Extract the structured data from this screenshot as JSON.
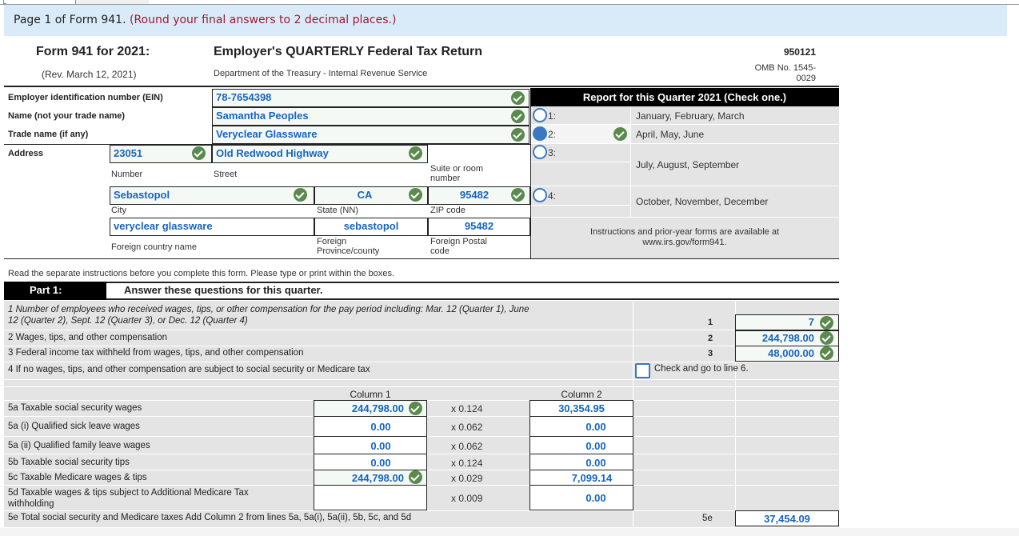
{
  "banner": {
    "text": "Page 1 of Form 941.",
    "hint": "(Round your final answers to 2 decimal places.)"
  },
  "header": {
    "form_title": "Form 941 for 2021:",
    "revision": "(Rev. March 12, 2021)",
    "title": "Employer's QUARTERLY Federal Tax Return",
    "department": "Department of the Treasury - Internal Revenue Service",
    "form_code": "950121",
    "omb_line1": "OMB No. 1545-",
    "omb_line2": "0029"
  },
  "employer": {
    "ein_label": "Employer identification number (EIN)",
    "ein_value": "78-7654398",
    "name_label": "Name (not your trade name)",
    "name_value": "Samantha Peoples",
    "trade_label": "Trade name (if any)",
    "trade_value": "Veryclear Glassware",
    "address_label": "Address",
    "number_value": "23051",
    "number_label": "Number",
    "street_value": "Old Redwood Highway",
    "street_label": "Street",
    "suite_label": "Suite or room number",
    "city_value": "Sebastopol",
    "city_label": "City",
    "state_value": "CA",
    "state_label": "State (NN)",
    "zip_value": "95482",
    "zip_label": "ZIP code",
    "foreign_country_value": "veryclear glassware",
    "foreign_country_label": "Foreign country name",
    "foreign_province_value": "sebastopol",
    "foreign_province_label_1": "Foreign",
    "foreign_province_label_2": "Province/county",
    "foreign_postal_value": "95482",
    "foreign_postal_label_1": "Foreign Postal",
    "foreign_postal_label_2": "code"
  },
  "quarter": {
    "heading": "Report for this Quarter 2021 (Check one.)",
    "options": [
      {
        "num": "1:",
        "months": "January, February, March",
        "selected": false
      },
      {
        "num": "2:",
        "months": "April, May, June",
        "selected": true
      },
      {
        "num": "3:",
        "months": "July, August, September",
        "selected": false
      },
      {
        "num": "4:",
        "months": "October, November, December",
        "selected": false
      }
    ],
    "instructions_1": "Instructions and prior-year forms are available at",
    "instructions_2": "www.irs.gov/form941."
  },
  "read_note": "Read the separate instructions before you complete this form.  Please type or print within the boxes.",
  "part1": {
    "label": "Part 1:",
    "title": "Answer these questions for this quarter.",
    "line1_text_1": "1  Number of employees who received wages, tips, or other compensation for the pay period including: Mar. 12 (Quarter 1), June",
    "line1_text_2": "12 (Quarter 2), Sept. 12 (Quarter 3), or Dec. 12 (Quarter 4)",
    "line1_num": "1",
    "line1_value": "7",
    "line2_text": "2  Wages, tips, and other compensation",
    "line2_num": "2",
    "line2_value": "244,798.00",
    "line3_text": "3  Federal income tax withheld from wages, tips, and other compensation",
    "line3_num": "3",
    "line3_value": "48,000.00",
    "line4_text": "4  If no wages, tips, and other compensation are subject to social security or Medicare tax",
    "line4_check_label": "Check and go to line 6.",
    "column1_label": "Column 1",
    "column2_label": "Column 2",
    "line5_rows": [
      {
        "label": "5a Taxable social security wages",
        "col1": "244,798.00",
        "mult": "x 0.124",
        "col2": "30,354.95"
      },
      {
        "label": "5a (i) Qualified sick leave wages",
        "col1": "0.00",
        "mult": "x 0.062",
        "col2": "0.00"
      },
      {
        "label": "5a (ii) Qualified family leave wages",
        "col1": "0.00",
        "mult": "x 0.062",
        "col2": "0.00"
      },
      {
        "label": "5b Taxable social security tips",
        "col1": "0.00",
        "mult": "x 0.124",
        "col2": "0.00"
      },
      {
        "label": "5c Taxable Medicare wages & tips",
        "col1": "244,798.00",
        "mult": "x 0.029",
        "col2": "7,099.14"
      },
      {
        "label_1": "5d Taxable wages & tips subject to Additional Medicare Tax",
        "label_2": "withholding",
        "col1": "",
        "mult": "x 0.009",
        "col2": "0.00"
      }
    ],
    "line5e_text": "5e Total social security and Medicare taxes Add Column 2 from lines 5a, 5a(i), 5a(ii), 5b, 5c, and 5d",
    "line5e_num": "5e",
    "line5e_value": "37,454.09"
  },
  "colors": {
    "value_text": "#1565c0",
    "check_badge": "#5a8a4e",
    "radio": "#3a78c3",
    "hint": "#a0192e",
    "banner_bg": "#d9ebf9"
  }
}
